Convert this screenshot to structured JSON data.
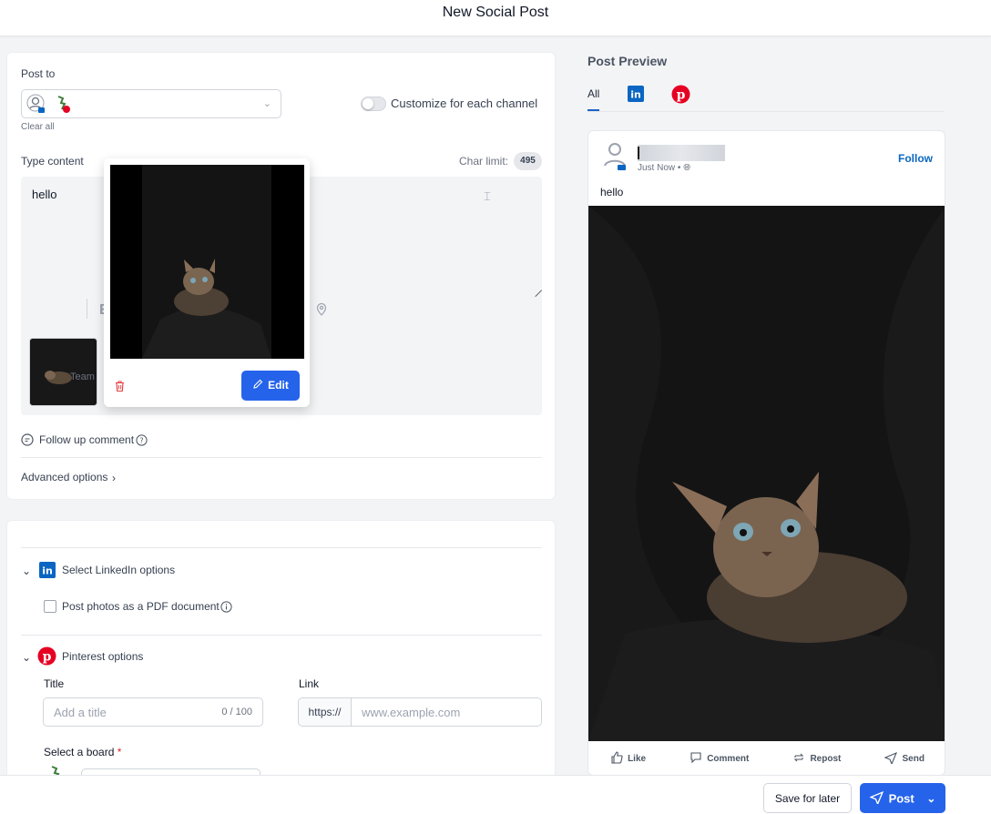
{
  "header": {
    "title": "New Social Post"
  },
  "compose": {
    "post_to_label": "Post to",
    "clear_all": "Clear all",
    "customize_label": "Customize for each channel",
    "type_content_label": "Type content",
    "char_limit_label": "Char limit:",
    "char_limit_value": "495",
    "content_text": "hello",
    "toolbar_fragment": "E",
    "thumb_overlay_text": "Team",
    "follow_up_label": "Follow up comment",
    "advanced_label": "Advanced options"
  },
  "media_popover": {
    "edit_label": "Edit"
  },
  "linkedin_options": {
    "title": "Select LinkedIn options",
    "pdf_label": "Post photos as a PDF document"
  },
  "pinterest_options": {
    "title": "Pinterest options",
    "title_label": "Title",
    "title_placeholder": "Add a title",
    "title_count": "0 / 100",
    "link_label": "Link",
    "link_prefix": "https://",
    "link_placeholder": "www.example.com",
    "board_label": "Select a board",
    "required_mark": "*"
  },
  "preview": {
    "title": "Post Preview",
    "tab_all": "All",
    "time": "Just Now •",
    "follow": "Follow",
    "text": "hello",
    "actions": [
      "Like",
      "Comment",
      "Repost",
      "Send"
    ]
  },
  "footer": {
    "save_label": "Save for later",
    "post_label": "Post"
  },
  "colors": {
    "primary": "#2563eb",
    "linkedin": "#0a66c2",
    "pinterest": "#e60023"
  }
}
